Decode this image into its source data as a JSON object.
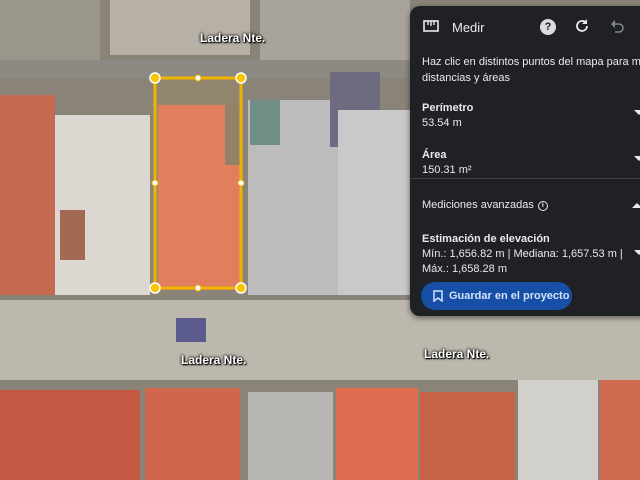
{
  "map": {
    "street_top": "Ladera Nte.",
    "street_bottom_left": "Ladera Nte.",
    "street_bottom_right": "Ladera Nte.",
    "measure_color": "#f0b400"
  },
  "panel": {
    "title": "Medir",
    "icons": [
      "ruler-icon",
      "help-icon",
      "refresh-icon",
      "undo-icon"
    ],
    "help_symbol": "?",
    "description_line1": "Haz clic en distintos puntos del mapa para medir",
    "description_line2": "distancias y áreas",
    "perimeter_label": "Perímetro",
    "perimeter_value": "53.54 m",
    "area_label": "Área",
    "area_value": "150.31 m²",
    "advanced_label": "Mediciones avanzadas",
    "elevation_label": "Estimación de elevación",
    "elevation_line1": "Mín.: 1,656.82 m | Mediana: 1,657.53 m |",
    "elevation_line2": "Máx.: 1,658.28 m",
    "save_button_label": "Guardar en el proyecto"
  }
}
